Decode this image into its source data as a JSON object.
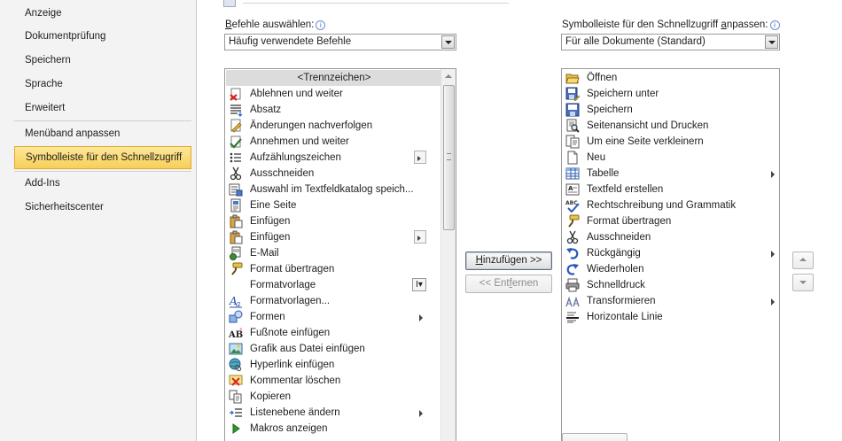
{
  "sidebar": {
    "items": [
      {
        "label": "Anzeige",
        "active": false
      },
      {
        "label": "Dokumentprüfung",
        "active": false
      },
      {
        "label": "Speichern",
        "active": false
      },
      {
        "label": "Sprache",
        "active": false
      },
      {
        "label": "Erweitert",
        "active": false
      },
      {
        "label": "Menüband anpassen",
        "active": false
      },
      {
        "label": "Symbolleiste für den Schnellzugriff",
        "active": true
      },
      {
        "label": "Add-Ins",
        "active": false
      },
      {
        "label": "Sicherheitscenter",
        "active": false
      }
    ]
  },
  "left_panel": {
    "label_pre": "",
    "label_key": "B",
    "label_post": "efehle auswählen:",
    "combo_value": "Häufig verwendete Befehle",
    "commands": [
      {
        "label": "<Trennzeichen>",
        "icon": "separator-icon"
      },
      {
        "label": "Ablehnen und weiter",
        "icon": "reject-change-icon"
      },
      {
        "label": "Absatz",
        "icon": "paragraph-icon"
      },
      {
        "label": "Änderungen nachverfolgen",
        "icon": "track-changes-icon"
      },
      {
        "label": "Annehmen und weiter",
        "icon": "accept-change-icon"
      },
      {
        "label": "Aufzählungszeichen",
        "icon": "bullets-icon"
      },
      {
        "label": "Ausschneiden",
        "icon": "cut-icon"
      },
      {
        "label": "Auswahl im Textfeldkatalog speich...",
        "icon": "textbox-gallery-icon"
      },
      {
        "label": "Eine Seite",
        "icon": "one-page-icon"
      },
      {
        "label": "Einfügen",
        "icon": "paste-icon"
      },
      {
        "label": "Einfügen",
        "icon": "paste-options-icon"
      },
      {
        "label": "E-Mail",
        "icon": "email-icon"
      },
      {
        "label": "Format übertragen",
        "icon": "format-painter-icon"
      },
      {
        "label": "Formatvorlage",
        "icon": "style-icon"
      },
      {
        "label": "Formatvorlagen...",
        "icon": "styles-icon"
      },
      {
        "label": "Formen",
        "icon": "shapes-icon"
      },
      {
        "label": "Fußnote einfügen",
        "icon": "footnote-icon"
      },
      {
        "label": "Grafik aus Datei einfügen",
        "icon": "picture-icon"
      },
      {
        "label": "Hyperlink einfügen",
        "icon": "hyperlink-icon"
      },
      {
        "label": "Kommentar löschen",
        "icon": "delete-comment-icon"
      },
      {
        "label": "Kopieren",
        "icon": "copy-icon"
      },
      {
        "label": "Listenebene ändern",
        "icon": "list-level-icon"
      },
      {
        "label": "Makros anzeigen",
        "icon": "macros-icon"
      }
    ]
  },
  "right_panel": {
    "label_pre": "Symbolleiste für den Schnellzugriff ",
    "label_key": "a",
    "label_post": "npassen:",
    "combo_value": "Für alle Dokumente (Standard)",
    "commands": [
      {
        "label": "Öffnen",
        "icon": "open-icon"
      },
      {
        "label": "Speichern unter",
        "icon": "save-as-icon"
      },
      {
        "label": "Speichern",
        "icon": "save-icon"
      },
      {
        "label": "Seitenansicht und Drucken",
        "icon": "print-preview-icon"
      },
      {
        "label": "Um eine Seite verkleinern",
        "icon": "shrink-one-page-icon"
      },
      {
        "label": "Neu",
        "icon": "new-document-icon"
      },
      {
        "label": "Tabelle",
        "icon": "table-icon"
      },
      {
        "label": "Textfeld erstellen",
        "icon": "textbox-icon"
      },
      {
        "label": "Rechtschreibung und Grammatik",
        "icon": "spelling-icon"
      },
      {
        "label": "Format übertragen",
        "icon": "format-painter-icon"
      },
      {
        "label": "Ausschneiden",
        "icon": "cut-icon"
      },
      {
        "label": "Rückgängig",
        "icon": "undo-icon"
      },
      {
        "label": "Wiederholen",
        "icon": "redo-icon"
      },
      {
        "label": "Schnelldruck",
        "icon": "quick-print-icon"
      },
      {
        "label": "Transformieren",
        "icon": "transform-icon"
      },
      {
        "label": "Horizontale Linie",
        "icon": "horizontal-line-icon"
      }
    ]
  },
  "buttons": {
    "add": {
      "key": "H",
      "rest": "inzufügen >>"
    },
    "remove": {
      "pre": "<< Ent",
      "key": "f",
      "post": "ernen"
    }
  },
  "colors": {
    "accent": "#f8cf58",
    "selection": "#dcdcdc"
  }
}
